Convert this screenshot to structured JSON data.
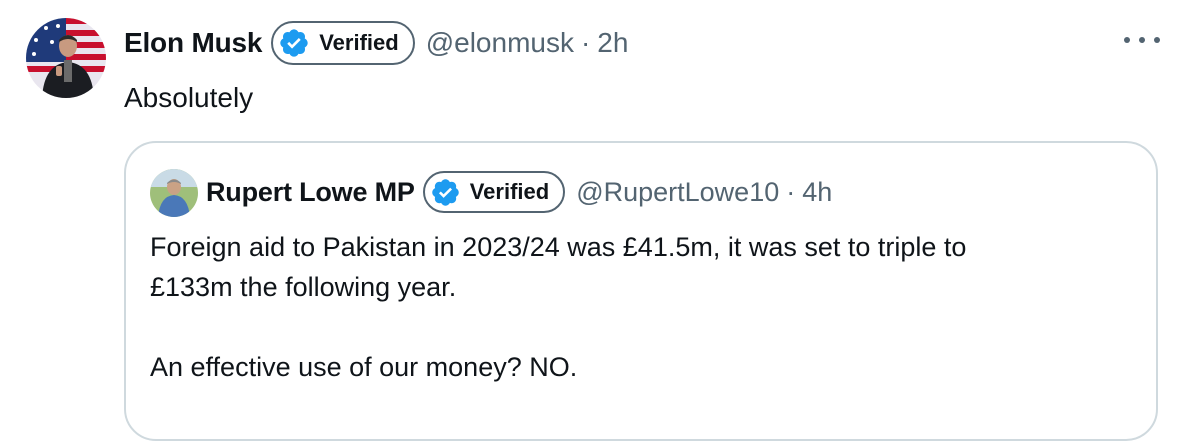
{
  "tweet": {
    "author": {
      "display_name": "Elon Musk",
      "verified_label": "Verified",
      "handle": "@elonmusk",
      "separator": "·",
      "time": "2h"
    },
    "text": "Absolutely",
    "more_icon": "more-horizontal-icon"
  },
  "quoted_tweet": {
    "author": {
      "display_name": "Rupert Lowe MP",
      "verified_label": "Verified",
      "handle": "@RupertLowe10",
      "separator": "·",
      "time": "4h"
    },
    "text": "Foreign aid to Pakistan in 2023/24 was £41.5m, it was set to triple to\n£133m the following year.\n\nAn effective use of our money? NO."
  },
  "colors": {
    "verified_blue": "#1d9bf0",
    "secondary_text": "#536471",
    "primary_text": "#0f1419",
    "card_border": "#cfd9de"
  }
}
